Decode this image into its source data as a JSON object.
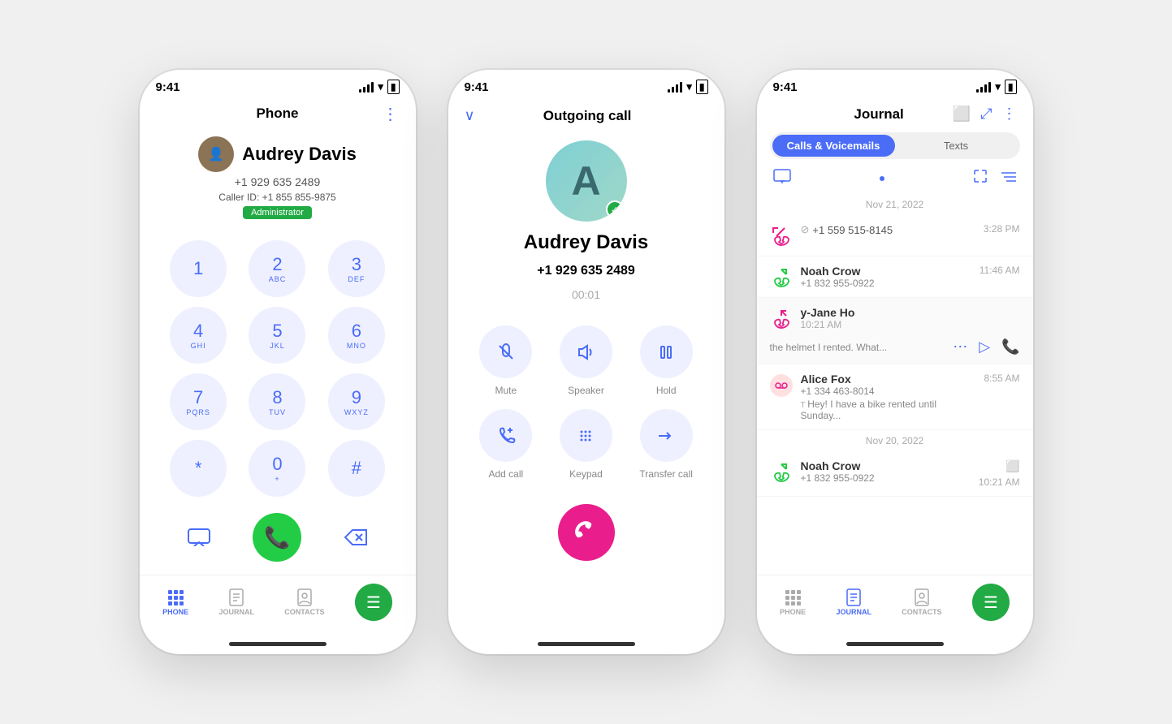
{
  "phone1": {
    "status_time": "9:41",
    "title": "Phone",
    "contact_name": "Audrey Davis",
    "contact_number": "+1 929 635 2489",
    "caller_id": "Caller ID: +1 855 855-9875",
    "badge": "Administrator",
    "dialpad": [
      {
        "number": "1",
        "letters": ""
      },
      {
        "number": "2",
        "letters": "ABC"
      },
      {
        "number": "3",
        "letters": "DEF"
      },
      {
        "number": "4",
        "letters": "GHI"
      },
      {
        "number": "5",
        "letters": "JKL"
      },
      {
        "number": "6",
        "letters": "MNO"
      },
      {
        "number": "7",
        "letters": "PQRS"
      },
      {
        "number": "8",
        "letters": "TUV"
      },
      {
        "number": "9",
        "letters": "WXYZ"
      },
      {
        "number": "*",
        "letters": ""
      },
      {
        "number": "0",
        "letters": "+"
      },
      {
        "number": "#",
        "letters": ""
      }
    ],
    "tabs": [
      {
        "label": "PHONE",
        "active": true
      },
      {
        "label": "JOURNAL",
        "active": false
      },
      {
        "label": "CONTACTS",
        "active": false
      }
    ]
  },
  "phone2": {
    "status_time": "9:41",
    "title": "Outgoing call",
    "caller_name": "Audrey Davis",
    "caller_number": "+1 929 635 2489",
    "call_timer": "00:01",
    "controls": [
      {
        "icon": "🎙️",
        "label": "Mute"
      },
      {
        "icon": "🔊",
        "label": "Speaker"
      },
      {
        "icon": "⏸",
        "label": "Hold"
      },
      {
        "icon": "➕",
        "label": "Add call"
      },
      {
        "icon": "⠿",
        "label": "Keypad"
      },
      {
        "icon": "→",
        "label": "Transfer call"
      }
    ]
  },
  "phone3": {
    "status_time": "9:41",
    "title": "Journal",
    "tabs": [
      "Calls & Voicemails",
      "Texts"
    ],
    "active_tab": 0,
    "date1": "Nov 21, 2022",
    "date2": "Nov 20, 2022",
    "entries": [
      {
        "type": "missed",
        "number": "+1 559 515-8145",
        "time": "3:28 PM",
        "preview": ""
      },
      {
        "type": "outgoing",
        "name": "Noah Crow",
        "number": "+1 832 955-0922",
        "time": "11:46 AM",
        "preview": ""
      },
      {
        "type": "incoming",
        "name": "y-Jane Ho",
        "number": "",
        "time": "10:21 AM",
        "preview": "the helmet I rented. What..."
      },
      {
        "type": "voicemail",
        "name": "Alice Fox",
        "number": "+1 334 463-8014",
        "time": "8:55 AM",
        "preview": "Hey! I have a bike rented until Sunday..."
      }
    ],
    "entries2": [
      {
        "type": "outgoing",
        "name": "Noah Crow",
        "number": "+1 832 955-0922",
        "time": "10:21 AM",
        "preview": ""
      }
    ],
    "tabs_bottom": [
      {
        "label": "PHONE",
        "active": false
      },
      {
        "label": "JOURNAL",
        "active": true
      },
      {
        "label": "CONTACTS",
        "active": false
      }
    ]
  }
}
